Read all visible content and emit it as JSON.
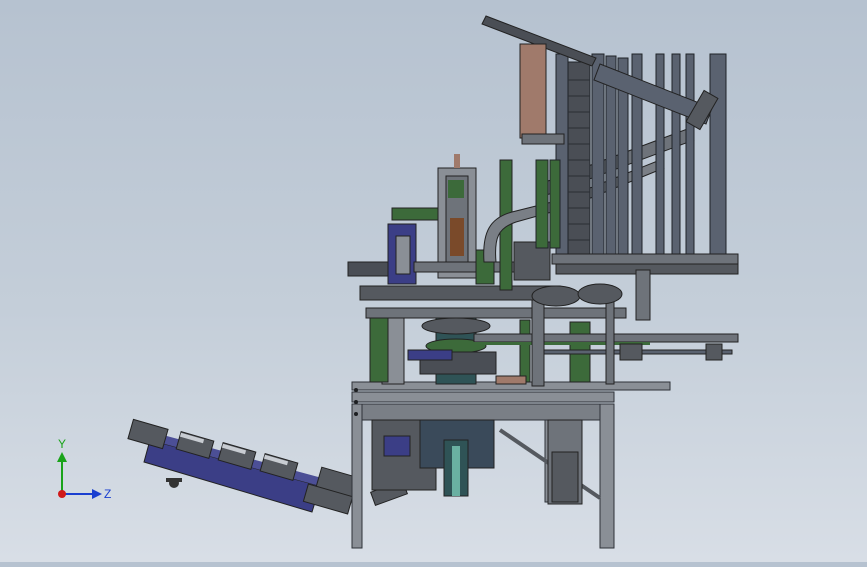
{
  "viewport": {
    "background_top": "#b6c2d0",
    "background_bottom": "#d8dee6"
  },
  "model": {
    "colors": {
      "frame": "#8a8f96",
      "frame_dark": "#4a4e55",
      "green": "#3c6a3a",
      "blue_parts": "#3b3e86",
      "steel": "#6e737a",
      "teal": "#2f5356",
      "tan": "#a07a6b",
      "rod": "#5a6270"
    }
  },
  "triad": {
    "y_label": "Y",
    "z_label": "Z",
    "y_color": "#1aa31a",
    "z_color": "#1a3fd0",
    "x_color": "#d01a1a"
  }
}
